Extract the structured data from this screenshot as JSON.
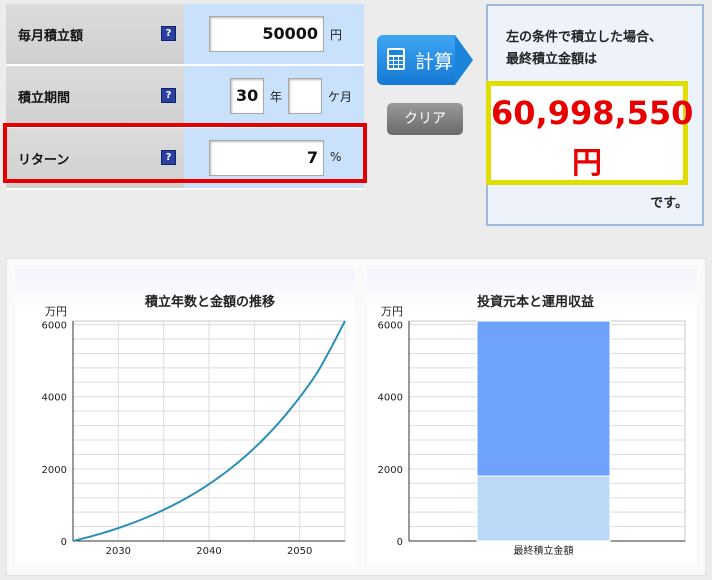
{
  "form": {
    "monthly": {
      "label": "毎月積立額",
      "help": "?",
      "value": "50000",
      "unit": "円"
    },
    "period": {
      "label": "積立期間",
      "help": "?",
      "years": "30",
      "years_unit": "年",
      "months": "",
      "months_unit": "ケ月"
    },
    "return": {
      "label": "リターン",
      "help": "?",
      "value": "7",
      "unit": "%"
    }
  },
  "buttons": {
    "calc": "計算",
    "clear": "クリア"
  },
  "result": {
    "line1": "左の条件で積立した場合、",
    "line2": "最終積立金額は",
    "amount": "60,998,550",
    "currency": "円",
    "suffix": "です。"
  },
  "chart_data": [
    {
      "type": "line",
      "title": "積立年数と金額の推移",
      "ylabel": "万円",
      "ylim": [
        0,
        6100
      ],
      "xlim": [
        2025,
        2055
      ],
      "xticks": [
        "2030",
        "2040",
        "2050"
      ],
      "yticks": [
        "0",
        "2000",
        "4000",
        "6000"
      ],
      "series": [
        {
          "color": "#2a8fb8",
          "x": [
            2025,
            2028,
            2031,
            2034,
            2037,
            2040,
            2043,
            2046,
            2049,
            2052,
            2055
          ],
          "y": [
            0,
            199,
            446,
            749,
            1120,
            1576,
            2135,
            2821,
            3664,
            4697,
            6100
          ]
        }
      ]
    },
    {
      "type": "bar",
      "title": "投資元本と運用収益",
      "ylabel": "万円",
      "ylim": [
        0,
        6100
      ],
      "yticks": [
        "0",
        "2000",
        "4000",
        "6000"
      ],
      "categories": [
        "最終積立金額"
      ],
      "series": [
        {
          "values": [
            1800
          ],
          "color": "#bcd8f7"
        },
        {
          "values": [
            4300
          ],
          "color": "#6fa2fb"
        }
      ]
    }
  ]
}
